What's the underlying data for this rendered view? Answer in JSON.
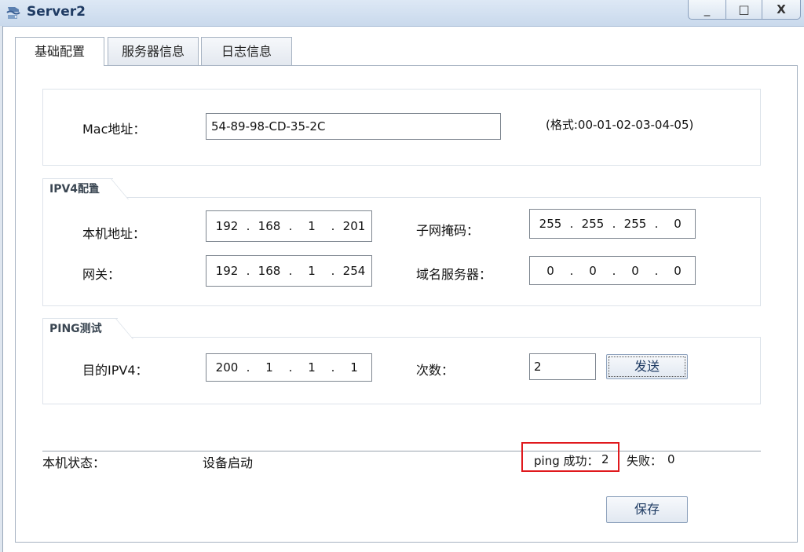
{
  "window": {
    "title": "Server2",
    "controls": {
      "minimize": "_",
      "maximize": "□",
      "close": "X"
    }
  },
  "tabs": [
    {
      "label": "基础配置",
      "active": true
    },
    {
      "label": "服务器信息",
      "active": false
    },
    {
      "label": "日志信息",
      "active": false
    }
  ],
  "mac": {
    "label": "Mac地址：",
    "value": "54-89-98-CD-35-2C",
    "hint": "(格式:00-01-02-03-04-05)"
  },
  "ipv4": {
    "group_title": "IPV4配置",
    "local_address": {
      "label": "本机地址：",
      "octets": [
        "192",
        "168",
        "1",
        "201"
      ]
    },
    "subnet_mask": {
      "label": "子网掩码：",
      "octets": [
        "255",
        "255",
        "255",
        "0"
      ]
    },
    "gateway": {
      "label": "网关：",
      "octets": [
        "192",
        "168",
        "1",
        "254"
      ]
    },
    "dns": {
      "label": "域名服务器：",
      "octets": [
        "0",
        "0",
        "0",
        "0"
      ]
    }
  },
  "ping": {
    "group_title": "PING测试",
    "target": {
      "label": "目的IPV4：",
      "octets": [
        "200",
        "1",
        "1",
        "1"
      ]
    },
    "count": {
      "label": "次数：",
      "value": "2"
    },
    "send_label": "发送"
  },
  "status": {
    "label": "本机状态：",
    "value": "设备启动",
    "success_label": "ping 成功：",
    "success_count": "2",
    "fail_label": "失败：",
    "fail_count": "0"
  },
  "save_label": "保存",
  "colors": {
    "highlight": "#e0191d",
    "titlebar": "#c9d9ec"
  }
}
